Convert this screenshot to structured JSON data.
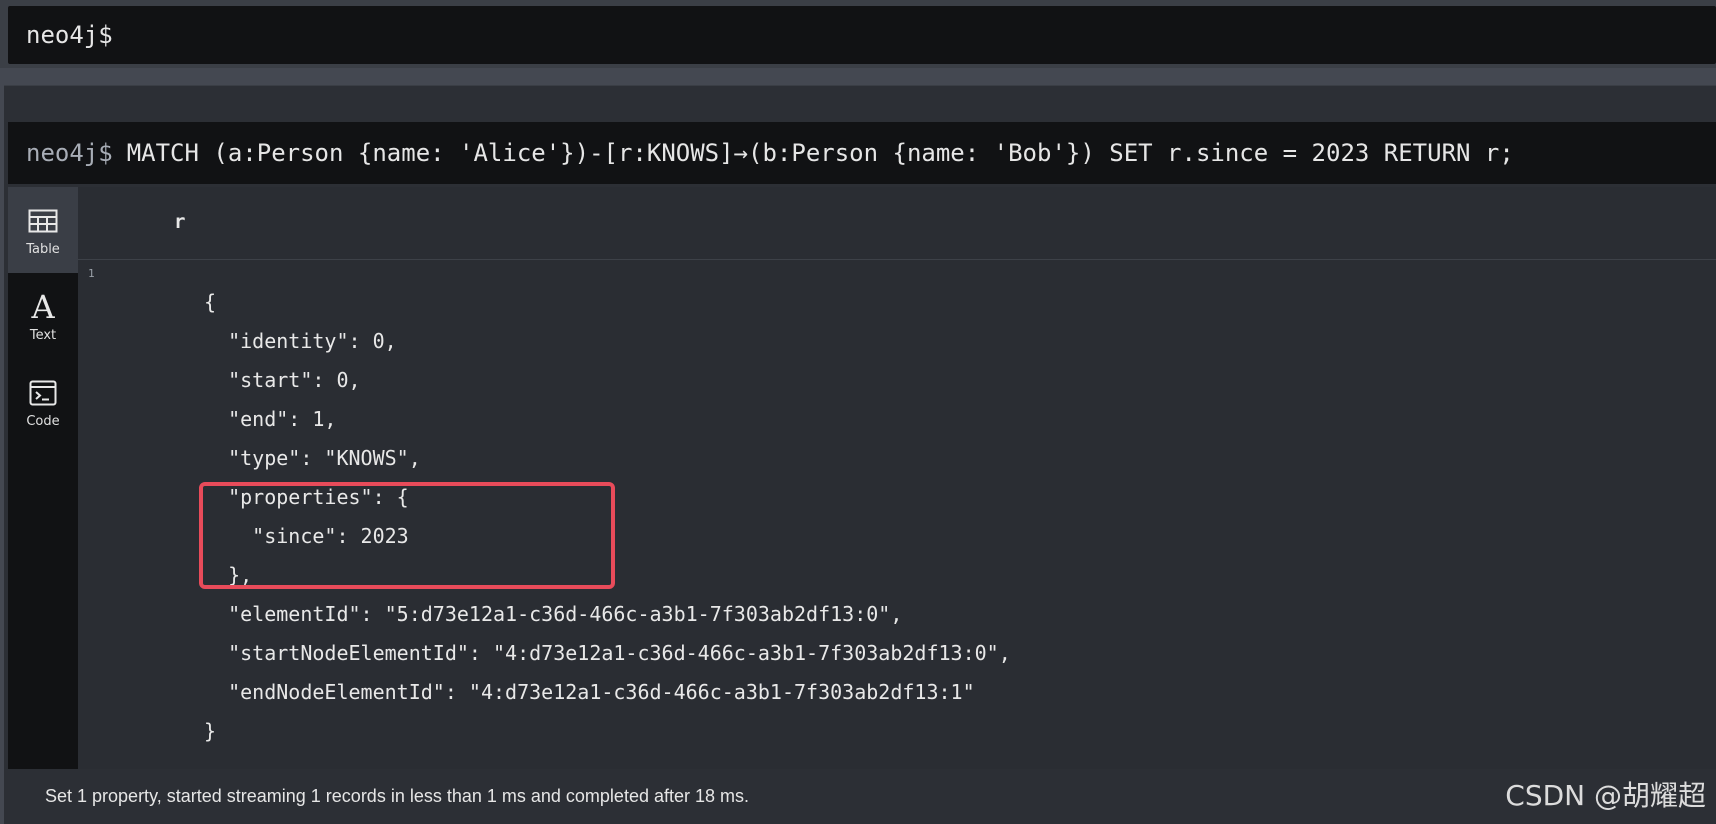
{
  "top_prompt": {
    "text": "neo4j$"
  },
  "query": {
    "prompt": "neo4j$",
    "text": "MATCH (a:Person {name: 'Alice'})-[r:KNOWS]→(b:Person {name: 'Bob'}) SET r.since = 2023 RETURN r;"
  },
  "sidebar": {
    "items": [
      {
        "label": "Table",
        "icon": "table-icon",
        "active": true
      },
      {
        "label": "Text",
        "icon": "text-icon",
        "active": false
      },
      {
        "label": "Code",
        "icon": "code-icon",
        "active": false
      }
    ]
  },
  "result": {
    "column": "r",
    "row_number": "1",
    "lines": [
      "{",
      "  \"identity\": 0,",
      "  \"start\": 0,",
      "  \"end\": 1,",
      "  \"type\": \"KNOWS\",",
      "  \"properties\": {",
      "    \"since\": 2023",
      "  },",
      "  \"elementId\": \"5:d73e12a1-c36d-466c-a3b1-7f303ab2df13:0\",",
      "  \"startNodeElementId\": \"4:d73e12a1-c36d-466c-a3b1-7f303ab2df13:0\",",
      "  \"endNodeElementId\": \"4:d73e12a1-c36d-466c-a3b1-7f303ab2df13:1\"",
      "}"
    ]
  },
  "status": {
    "text": "Set 1 property, started streaming 1 records in less than 1 ms and completed after 18 ms."
  },
  "watermark": {
    "text": "CSDN @胡耀超"
  },
  "colors": {
    "highlight": "#e84b5a",
    "background": "#2a2d33",
    "prompt_bg": "#111214"
  }
}
